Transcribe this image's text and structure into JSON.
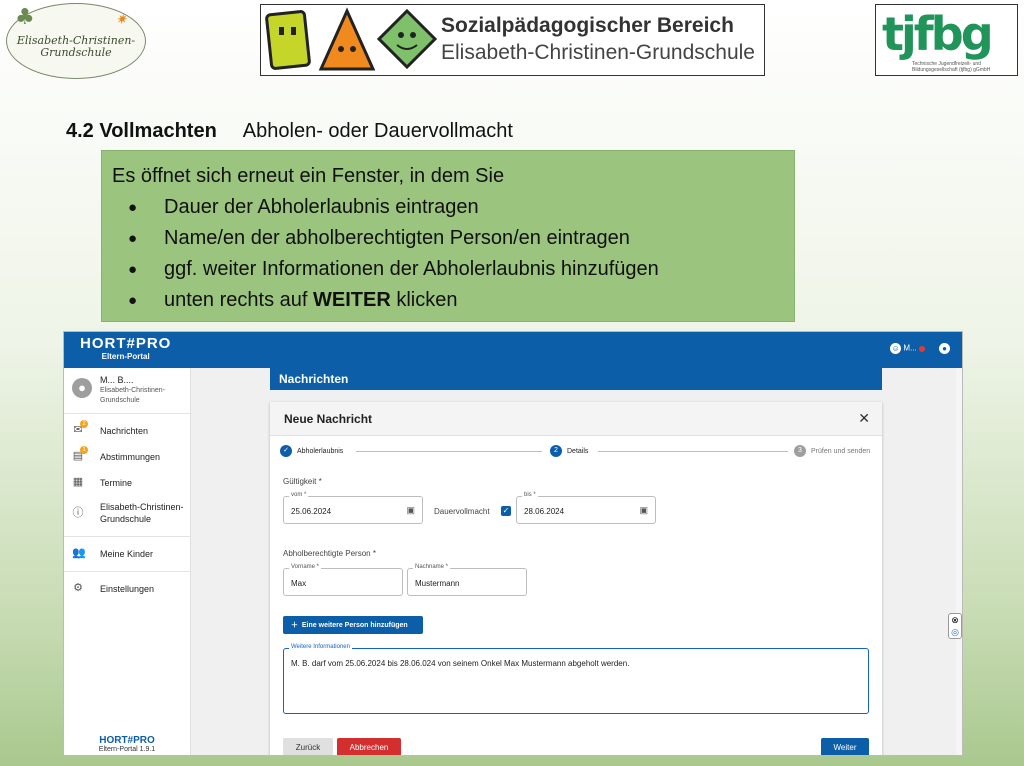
{
  "header": {
    "left_logo_text": "Elisabeth-Christinen-\nGrundschule",
    "banner_title": "Sozialpädagogischer Bereich",
    "banner_subtitle": "Elisabeth-Christinen-Grundschule",
    "right_logo_mark": "tjfbg",
    "right_logo_small": "Technische Jugendfreizeit- und Bildungsgesellschaft (tjfbg) gGmbH"
  },
  "slide": {
    "heading_bold": "4.2 Vollmachten",
    "heading_rest": "Abholen- oder Dauervollmacht",
    "intro": "Es öffnet sich erneut ein Fenster, in dem Sie",
    "bullets": [
      "Dauer der Abholerlaubnis eintragen",
      "Name/en der abholberechtigten Person/en eintragen",
      "ggf. weiter Informationen der Abholerlaubnis hinzufügen"
    ],
    "last_bullet_pre": "unten rechts auf ",
    "last_bullet_bold": "WEITER",
    "last_bullet_post": " klicken"
  },
  "app": {
    "brand_name": "HORT#PRO",
    "brand_sub": "Eltern-Portal",
    "top_user": "M...",
    "user_name": "M... B....",
    "user_school": "Elisabeth-Christinen-Grundschule",
    "nav": [
      {
        "label": "Nachrichten",
        "badge": "2"
      },
      {
        "label": "Abstimmungen",
        "badge": "1"
      },
      {
        "label": "Termine"
      },
      {
        "label": "Elisabeth-Christinen-Grundschule"
      },
      {
        "label": "Meine Kinder"
      },
      {
        "label": "Einstellungen"
      }
    ],
    "footer_brand": "HORT#PRO",
    "footer_version": "Eltern-Portal 1.9.1",
    "section_title": "Nachrichten",
    "dialog": {
      "title": "Neue Nachricht",
      "steps": [
        {
          "label": "Abholerlaubnis",
          "num": "✓"
        },
        {
          "label": "Details",
          "num": "2"
        },
        {
          "label": "Prüfen und senden",
          "num": "3"
        }
      ],
      "validity_label": "Gültigkeit *",
      "from_label": "vom *",
      "from_value": "25.06.2024",
      "permanent_label": "Dauervollmacht",
      "to_label": "bis *",
      "to_value": "28.06.2024",
      "person_label": "Abholberechtigte Person *",
      "firstname_label": "Vorname *",
      "firstname_value": "Max",
      "lastname_label": "Nachname *",
      "lastname_value": "Mustermann",
      "add_person_label": "Eine weitere Person hinzufügen",
      "info_label": "Weitere Informationen",
      "info_value": "M. B. darf vom 25.06.2024 bis 28.06.024 von seinem Onkel Max Mustermann abgeholt werden.",
      "back_label": "Zurück",
      "cancel_label": "Abbrechen",
      "next_label": "Weiter"
    }
  },
  "colors": {
    "primary": "#0d5ea8",
    "cancel": "#d32f2f",
    "green_box": "#9bc47f"
  }
}
